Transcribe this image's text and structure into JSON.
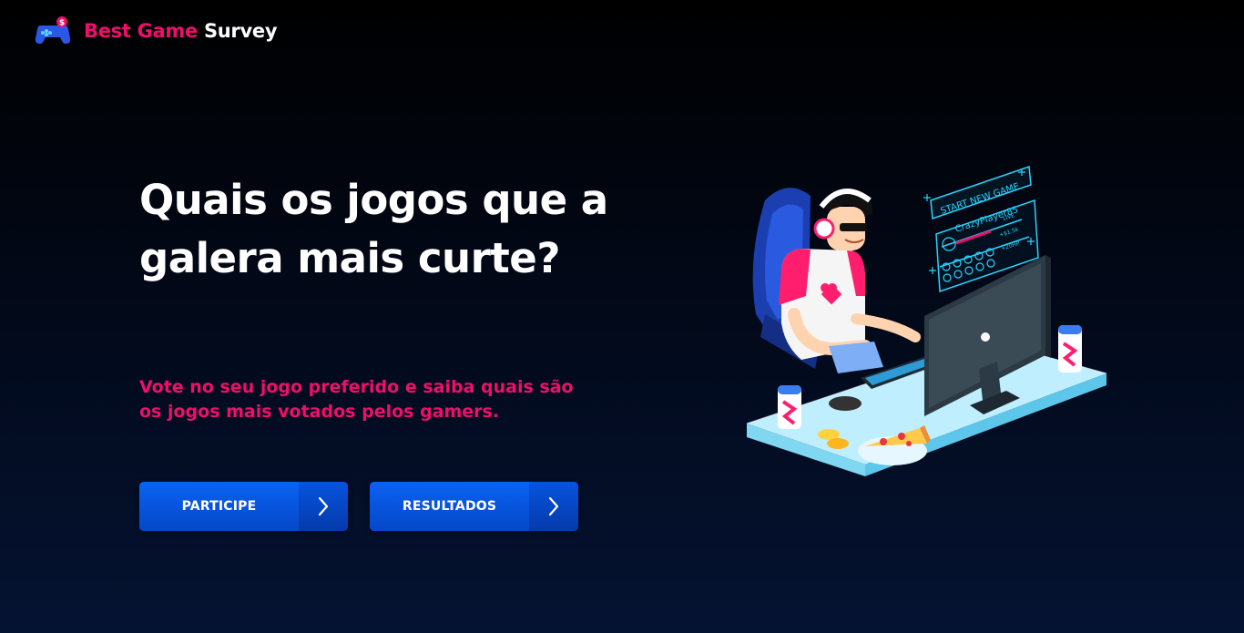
{
  "header": {
    "logo_icon": "gamepad-icon",
    "brand_accent": "Best Game",
    "brand_rest": "Survey"
  },
  "hero": {
    "title": "Quais os jogos que a galera mais curte?",
    "subtitle": "Vote no seu jogo preferido e saiba quais são os jogos mais votados pelos gamers."
  },
  "buttons": [
    {
      "label": "PARTICIPE",
      "icon": "chevron-right-icon"
    },
    {
      "label": "RESULTADOS",
      "icon": "chevron-right-icon"
    }
  ],
  "illustration": {
    "banner_text": "START NEW GAME",
    "player_name": "CrazyPlayer85",
    "player_status": "LIVE",
    "stat_1": "+$1.5k",
    "stat_2": "+20HP"
  },
  "colors": {
    "accent": "#ef0f6b",
    "button_blue": "#0a5be6",
    "background_top": "#000000",
    "background_bottom": "#051332"
  }
}
